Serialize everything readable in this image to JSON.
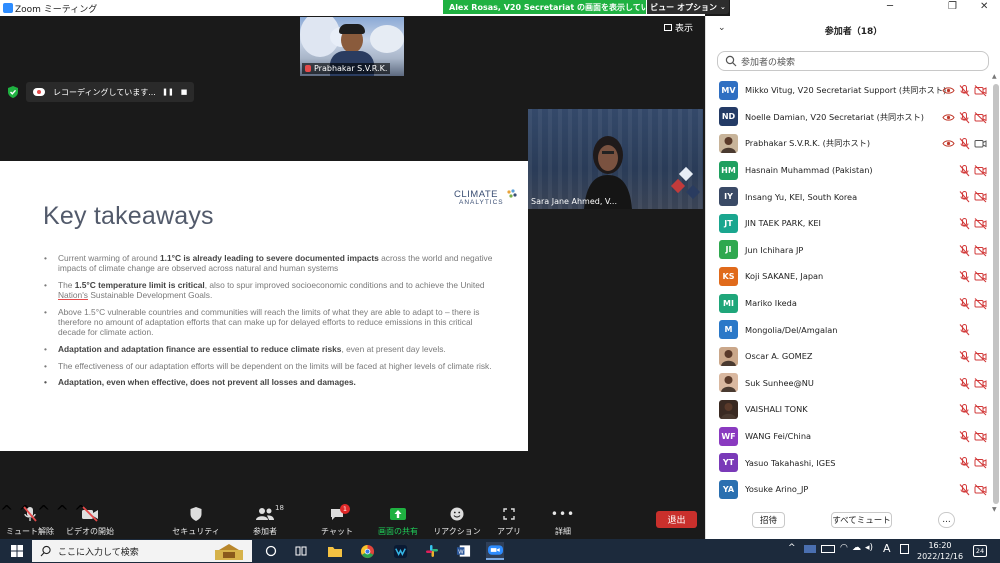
{
  "window": {
    "title": "Zoom ミーティング",
    "share_banner": "Alex Rosas, V20 Secretariat の画面を表示しています",
    "view_options": "ビュー オプション",
    "view_label": "表示"
  },
  "top_video": {
    "name": "Prabhakar S.V.R.K."
  },
  "recording": {
    "label": "レコーディングしています..."
  },
  "slide": {
    "title": "Key takeaways",
    "logo_line1": "CLIMATE",
    "logo_line2": "ANALYTICS",
    "bullets": [
      {
        "pre": "Current warming of around ",
        "bold": "1.1°C is already leading to severe documented impacts",
        "post": " across the world and negative impacts of climate change are observed across natural and human systems"
      },
      {
        "pre": "The ",
        "bold": "1.5°C temperature limit is critical",
        "post": ", also to spur improved socioeconomic conditions and to achieve the United Nation's Sustainable Development Goals."
      },
      {
        "pre": "Above 1.5°C vulnerable countries and communities will reach the limits of what they are able to adapt to – there is therefore no amount of adaptation efforts that can make up for delayed efforts to reduce emissions in this critical decade for climate action.",
        "bold": "",
        "post": ""
      },
      {
        "pre": "",
        "bold": "Adaptation and adaptation finance are essential to reduce climate risks",
        "post": ", even at present day levels."
      },
      {
        "pre": "The effectiveness of our adaptation efforts will be dependent on the limits will be faced at higher levels of climate risk.",
        "bold": "",
        "post": ""
      },
      {
        "pre": "",
        "bold": "Adaptation, even when effective, does not prevent all losses and damages.",
        "post": ""
      }
    ]
  },
  "video_tile": {
    "name": "Sara Jane Ahmed, V..."
  },
  "toolbar": {
    "unmute": "ミュート解除",
    "start_video": "ビデオの開始",
    "security": "セキュリティ",
    "participants": "参加者",
    "participants_count": "18",
    "chat": "チャット",
    "chat_badge": "1",
    "share": "画面の共有",
    "reactions": "リアクション",
    "apps": "アプリ",
    "more": "詳細",
    "leave": "退出"
  },
  "panel": {
    "title": "参加者（18）",
    "search_placeholder": "参加者の検索",
    "participants": [
      {
        "initials": "MV",
        "name": "Mikko Vitug, V20 Secretariat Support (共同ホスト)",
        "color": "#2f6fc2",
        "eye": true,
        "video_on": false
      },
      {
        "initials": "ND",
        "name": "Noelle Damian, V20 Secretariat (共同ホスト)",
        "color": "#243b66",
        "eye": true,
        "video_on": false
      },
      {
        "initials": "",
        "name": "Prabhakar S.V.R.K. (共同ホスト)",
        "color": "#c8b49a",
        "eye": true,
        "video_on": true
      },
      {
        "initials": "HM",
        "name": "Hasnain Muhammad (Pakistan)",
        "color": "#1fa060",
        "eye": false,
        "video_on": false
      },
      {
        "initials": "IY",
        "name": "Insang Yu, KEI, South Korea",
        "color": "#3a4a66",
        "eye": false,
        "video_on": false
      },
      {
        "initials": "JT",
        "name": "JIN TAEK PARK, KEI",
        "color": "#1aa68f",
        "eye": false,
        "video_on": false
      },
      {
        "initials": "JI",
        "name": "Jun Ichihara JP",
        "color": "#2fa84f",
        "eye": false,
        "video_on": false
      },
      {
        "initials": "KS",
        "name": "Koji SAKANE, Japan",
        "color": "#e06a1b",
        "eye": false,
        "video_on": false
      },
      {
        "initials": "MI",
        "name": "Mariko Ikeda",
        "color": "#1fa67a",
        "eye": false,
        "video_on": false
      },
      {
        "initials": "M",
        "name": "Mongolia/Del/Amgalan",
        "color": "#2a78c8",
        "eye": false,
        "video_on": null
      },
      {
        "initials": "",
        "name": "Oscar A. GOMEZ",
        "color": "#caa78a",
        "eye": false,
        "video_on": false
      },
      {
        "initials": "",
        "name": "Suk Sunhee@NU",
        "color": "#d9b8a0",
        "eye": false,
        "video_on": false
      },
      {
        "initials": "",
        "name": "VAISHALI TONK",
        "color": "#3a2a22",
        "eye": false,
        "video_on": false
      },
      {
        "initials": "WF",
        "name": "WANG Fei/China",
        "color": "#8a3ac0",
        "eye": false,
        "video_on": false
      },
      {
        "initials": "YT",
        "name": "Yasuo Takahashi, IGES",
        "color": "#7a3ab8",
        "eye": false,
        "video_on": false
      },
      {
        "initials": "YA",
        "name": "Yosuke Arino_JP",
        "color": "#2a6fb0",
        "eye": false,
        "video_on": false
      }
    ],
    "invite": "招待",
    "mute_all": "すべてミュート",
    "more": "…"
  },
  "taskbar": {
    "search_placeholder": "ここに入力して検索",
    "time": "16:20",
    "date": "2022/12/16",
    "ime": "A",
    "notifications": "24"
  }
}
